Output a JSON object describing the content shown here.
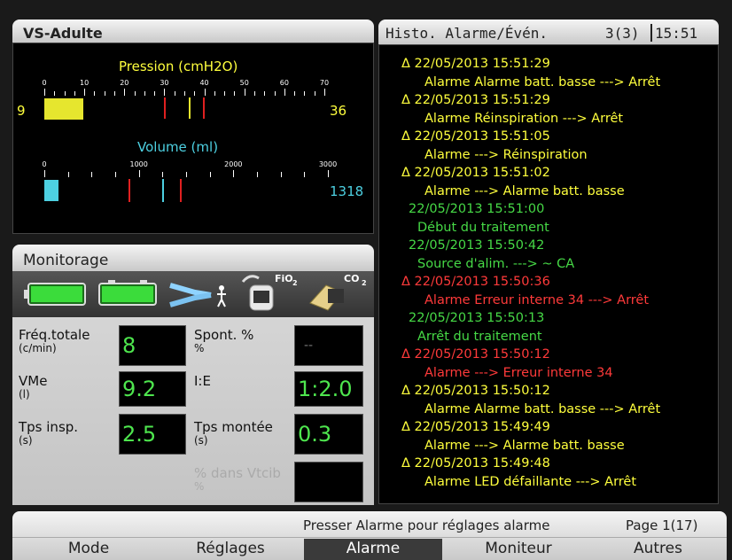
{
  "left_panel": {
    "title": "VS-Adulte",
    "pressure": {
      "label": "Pression (cmH2O)",
      "ticks": [
        "0",
        "10",
        "20",
        "30",
        "40",
        "50",
        "60",
        "70"
      ],
      "left_value": "9",
      "right_value": "36",
      "label_color": "#ffff3d"
    },
    "volume": {
      "label": "Volume (ml)",
      "ticks": [
        "0",
        "1000",
        "2000",
        "3000"
      ],
      "right_value": "1318",
      "label_color": "#4dd0e1"
    }
  },
  "monitoring": {
    "title": "Monitorage",
    "icons": {
      "battery1": "battery-icon",
      "battery2": "battery-external-icon",
      "patient": "patient-circuit-icon",
      "fio2": "fio2-sensor-icon",
      "fio2_label": "FiO",
      "co2": "co2-sensor-icon",
      "co2_label": "CO"
    },
    "rows": [
      {
        "label": "Fréq.totale",
        "unit": "(c/min)",
        "value": "8"
      },
      {
        "label": "Spont. %",
        "unit": "%",
        "value": "--"
      },
      {
        "label": "VMe",
        "unit": "(l)",
        "value": "9.2"
      },
      {
        "label": "I:E",
        "unit": "",
        "value": "1:2.0"
      },
      {
        "label": "Tps insp.",
        "unit": "(s)",
        "value": "2.5"
      },
      {
        "label": "Tps montée",
        "unit": "(s)",
        "value": "0.3"
      },
      {
        "label": "% dans Vtcib",
        "unit": "%",
        "value": ""
      }
    ]
  },
  "right_panel": {
    "title": "Histo. Alarme/Évén.",
    "count": "3(3)",
    "time": "15:51",
    "log": [
      {
        "text": "Δ 22/05/2013 15:51:29",
        "color": "yellow",
        "indent": false
      },
      {
        "text": "Alarme Alarme batt. basse ---> Arrêt",
        "color": "yellow",
        "indent": true
      },
      {
        "text": "Δ 22/05/2013 15:51:29",
        "color": "yellow",
        "indent": false
      },
      {
        "text": "Alarme Réinspiration ---> Arrêt",
        "color": "yellow",
        "indent": true
      },
      {
        "text": "Δ 22/05/2013 15:51:05",
        "color": "yellow",
        "indent": false
      },
      {
        "text": "Alarme ---> Réinspiration",
        "color": "yellow",
        "indent": true
      },
      {
        "text": "Δ 22/05/2013 15:51:02",
        "color": "yellow",
        "indent": false
      },
      {
        "text": "Alarme ---> Alarme batt. basse",
        "color": "yellow",
        "indent": true
      },
      {
        "text": "22/05/2013 15:51:00",
        "color": "green",
        "indent": false
      },
      {
        "text": "Début du traitement",
        "color": "green",
        "indent": true
      },
      {
        "text": "22/05/2013 15:50:42",
        "color": "green",
        "indent": false
      },
      {
        "text": "Source d'alim. ---> ~ CA",
        "color": "green",
        "indent": true
      },
      {
        "text": "Δ 22/05/2013 15:50:36",
        "color": "red",
        "indent": false
      },
      {
        "text": "Alarme Erreur interne 34 ---> Arrêt",
        "color": "red",
        "indent": true
      },
      {
        "text": "22/05/2013 15:50:13",
        "color": "green",
        "indent": false
      },
      {
        "text": "Arrêt du traitement",
        "color": "green",
        "indent": true
      },
      {
        "text": "Δ 22/05/2013 15:50:12",
        "color": "red",
        "indent": false
      },
      {
        "text": "Alarme ---> Erreur interne 34",
        "color": "red",
        "indent": true
      },
      {
        "text": "Δ 22/05/2013 15:50:12",
        "color": "yellow",
        "indent": false
      },
      {
        "text": "Alarme Alarme batt. basse ---> Arrêt",
        "color": "yellow",
        "indent": true
      },
      {
        "text": "Δ 22/05/2013 15:49:49",
        "color": "yellow",
        "indent": false
      },
      {
        "text": "Alarme ---> Alarme batt. basse",
        "color": "yellow",
        "indent": true
      },
      {
        "text": "Δ 22/05/2013 15:49:48",
        "color": "yellow",
        "indent": false
      },
      {
        "text": "Alarme LED défaillante ---> Arrêt",
        "color": "yellow",
        "indent": true
      }
    ]
  },
  "footer": {
    "hint": "Presser Alarme pour réglages alarme",
    "page": "Page 1(17)",
    "tabs": [
      "Mode",
      "Réglages",
      "Alarme",
      "Moniteur",
      "Autres"
    ],
    "active_tab": "Alarme"
  }
}
